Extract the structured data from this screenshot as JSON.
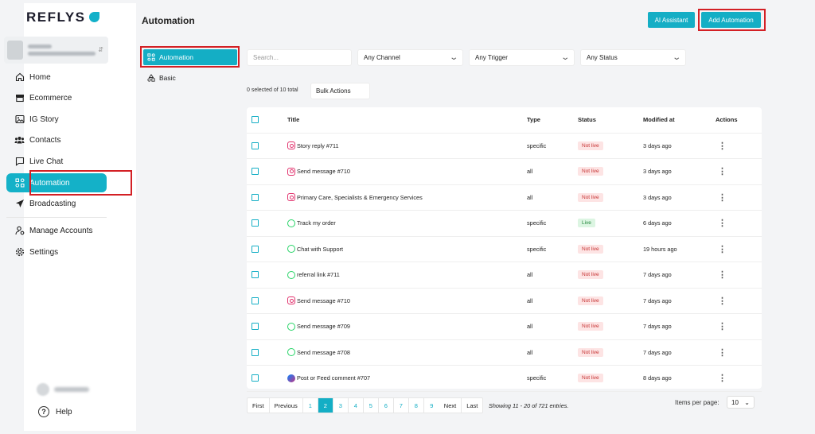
{
  "brand": {
    "name": "REFLYS"
  },
  "sidebar": {
    "items": [
      {
        "label": "Home"
      },
      {
        "label": "Ecommerce"
      },
      {
        "label": "IG Story"
      },
      {
        "label": "Contacts"
      },
      {
        "label": "Live Chat"
      },
      {
        "label": "Automation"
      },
      {
        "label": "Broadcasting"
      },
      {
        "label": "Manage Accounts"
      },
      {
        "label": "Settings"
      }
    ],
    "help_label": "Help"
  },
  "header": {
    "title": "Automation",
    "ai_assistant_label": "AI Assistant",
    "add_automation_label": "Add Automation"
  },
  "subnav": [
    {
      "label": "Automation"
    },
    {
      "label": "Basic"
    }
  ],
  "filters": {
    "search_placeholder": "Search...",
    "channel": "Any Channel",
    "trigger": "Any Trigger",
    "status": "Any Status"
  },
  "selection": {
    "text": "0 selected of 10 total",
    "bulk_label": "Bulk Actions"
  },
  "table": {
    "columns": [
      "Title",
      "Type",
      "Status",
      "Modified at",
      "Actions"
    ],
    "rows": [
      {
        "channel": "instagram",
        "title": "Story reply #711",
        "type": "specific",
        "status": "Not live",
        "modified": "3 days ago"
      },
      {
        "channel": "instagram",
        "title": "Send message #710",
        "type": "all",
        "status": "Not live",
        "modified": "3 days ago"
      },
      {
        "channel": "instagram",
        "title": "Primary Care, Specialists & Emergency Services",
        "type": "all",
        "status": "Not live",
        "modified": "3 days ago"
      },
      {
        "channel": "whatsapp",
        "title": "Track my order",
        "type": "specific",
        "status": "Live",
        "modified": "6 days ago"
      },
      {
        "channel": "whatsapp",
        "title": "Chat with Support",
        "type": "specific",
        "status": "Not live",
        "modified": "19 hours ago"
      },
      {
        "channel": "whatsapp",
        "title": "referral link #711",
        "type": "all",
        "status": "Not live",
        "modified": "7 days ago"
      },
      {
        "channel": "instagram",
        "title": "Send message #710",
        "type": "all",
        "status": "Not live",
        "modified": "7 days ago"
      },
      {
        "channel": "whatsapp",
        "title": "Send message #709",
        "type": "all",
        "status": "Not live",
        "modified": "7 days ago"
      },
      {
        "channel": "whatsapp",
        "title": "Send message #708",
        "type": "all",
        "status": "Not live",
        "modified": "7 days ago"
      },
      {
        "channel": "messenger",
        "title": "Post or Feed comment #707",
        "type": "specific",
        "status": "Not live",
        "modified": "8 days ago"
      }
    ]
  },
  "pagination": {
    "first": "First",
    "previous": "Previous",
    "next": "Next",
    "last": "Last",
    "pages": [
      "1",
      "2",
      "3",
      "4",
      "5",
      "6",
      "7",
      "8",
      "9"
    ],
    "current": "2",
    "showing": "Showing 11 - 20 of 721 entries.",
    "items_per_page_label": "Items per page:",
    "items_per_page": "10"
  },
  "colors": {
    "accent": "#14aec5",
    "highlight": "#d32025",
    "live": "#22863a",
    "not_live": "#c53030"
  }
}
